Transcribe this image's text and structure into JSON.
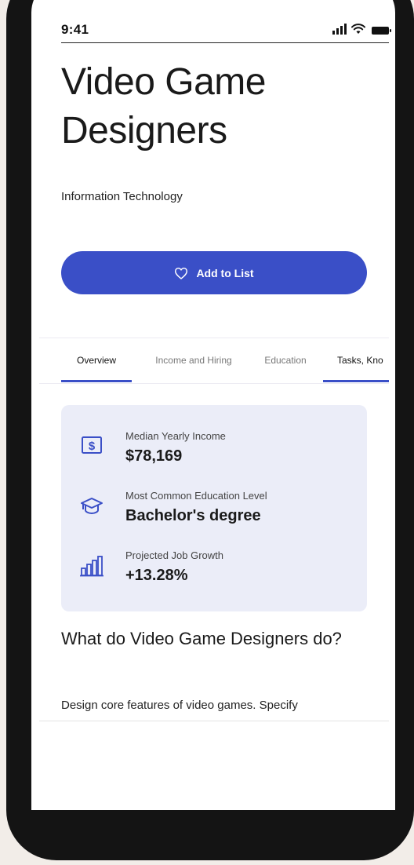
{
  "status_bar": {
    "time": "9:41"
  },
  "career": {
    "title": "Video Game Designers",
    "category": "Information Technology"
  },
  "actions": {
    "add_to_list": "Add to List"
  },
  "tabs": [
    {
      "label": "Overview",
      "active": true
    },
    {
      "label": "Income and Hiring",
      "active": false
    },
    {
      "label": "Education",
      "active": false
    },
    {
      "label": "Tasks, Kno",
      "active": false
    }
  ],
  "stats": [
    {
      "icon": "dollar-icon",
      "label": "Median Yearly Income",
      "value": "$78,169"
    },
    {
      "icon": "graduation-cap-icon",
      "label": "Most Common Education Level",
      "value": "Bachelor's degree"
    },
    {
      "icon": "bar-chart-icon",
      "label": "Projected Job Growth",
      "value": "+13.28%"
    }
  ],
  "description": {
    "heading": "What do Video Game Designers do?",
    "text": "Design core features of video games. Specify"
  },
  "colors": {
    "accent": "#3a4fc7",
    "card_bg": "#ebedf8",
    "page_bg": "#f2ede8"
  }
}
